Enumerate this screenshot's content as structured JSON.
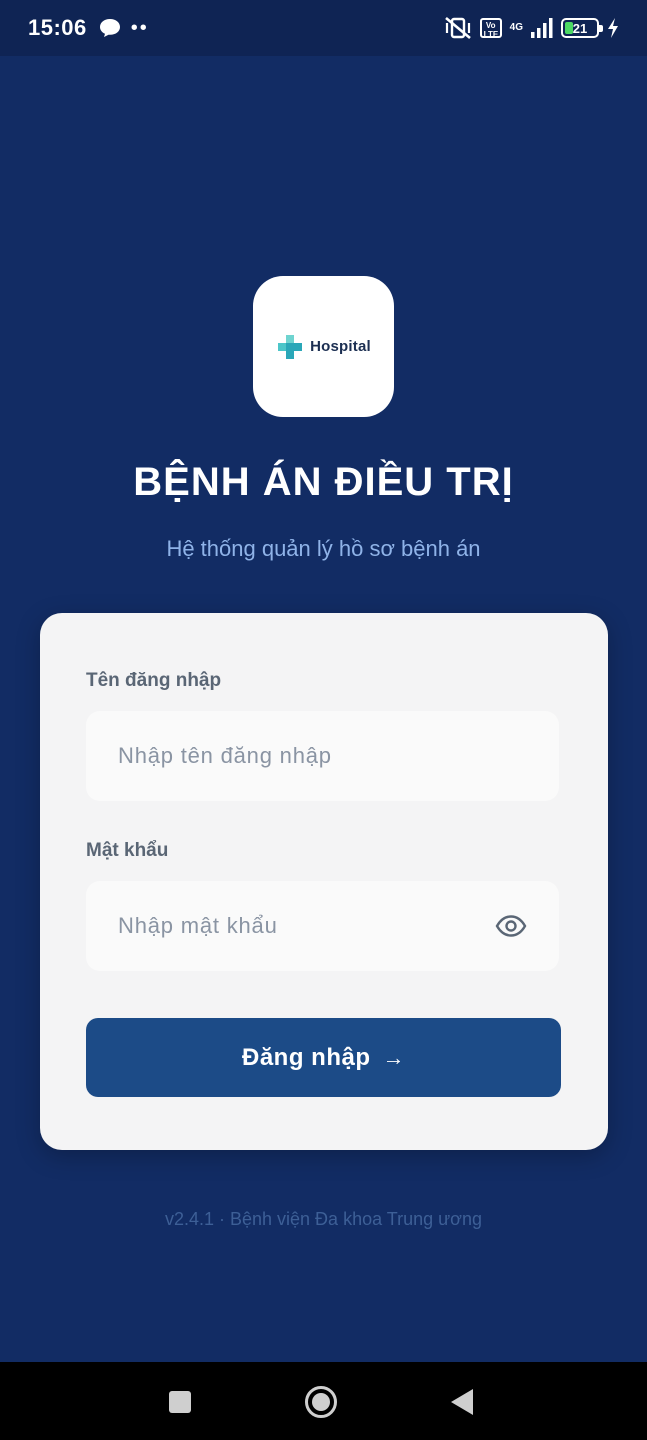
{
  "status_bar": {
    "time": "15:06",
    "dots": "••",
    "volte": "Vo LTE",
    "network": "4G",
    "battery": "21"
  },
  "logo": {
    "text": "Hospital",
    "icon": "medical-cross-icon"
  },
  "header": {
    "title": "BỆNH ÁN ĐIỀU TRỊ",
    "subtitle": "Hệ thống quản lý hồ sơ bệnh án"
  },
  "login_form": {
    "username_label": "Tên đăng nhập",
    "username_placeholder": "Nhập tên đăng nhập",
    "username_value": "",
    "password_label": "Mật khẩu",
    "password_placeholder": "Nhập mật khẩu",
    "password_value": "",
    "submit_label": "Đăng nhập",
    "submit_arrow": "→"
  },
  "footer": {
    "version_text": "v2.4.1 · Bệnh viện Đa khoa Trung ương"
  },
  "colors": {
    "background": "#122c64",
    "status_bar": "#0f2454",
    "card": "#f4f4f5",
    "button": "#1c4b87",
    "subtitle": "#8fb3e8",
    "logo_cross": "#2aa7b8"
  }
}
